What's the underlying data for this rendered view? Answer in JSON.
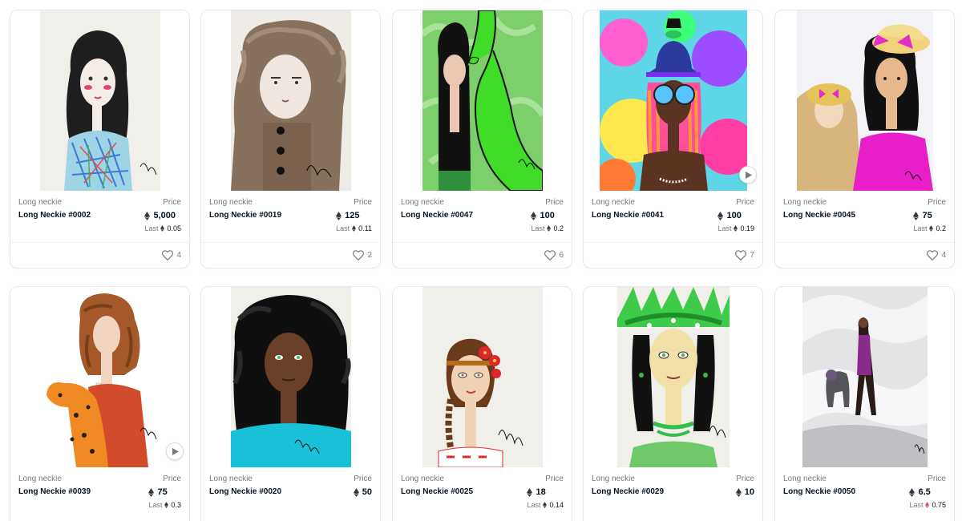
{
  "labels": {
    "price": "Price",
    "last": "Last"
  },
  "colors": {
    "eth_dark": "#353840",
    "eth_pink": "#e0467a",
    "muted": "#707a83",
    "text": "#04111d"
  },
  "items": [
    {
      "collection": "Long neckie",
      "name": "Long Neckie #0002",
      "price": "5,000",
      "last": "0.05",
      "likes": "4",
      "art": "pale-bg-dark-hair-pink-blush"
    },
    {
      "collection": "Long neckie",
      "name": "Long Neckie #0019",
      "price": "125",
      "last": "0.11",
      "likes": "2",
      "art": "fur-hood-brown"
    },
    {
      "collection": "Long neckie",
      "name": "Long Neckie #0047",
      "price": "100",
      "last": "0.2",
      "likes": "6",
      "art": "green-dinosaur"
    },
    {
      "collection": "Long neckie",
      "name": "Long Neckie #0041",
      "price": "100",
      "last": "0.19",
      "likes": "7",
      "art": "neon-bucket-hat",
      "video": true
    },
    {
      "collection": "Long neckie",
      "name": "Long Neckie #0045",
      "price": "75",
      "last": "0.2",
      "likes": "4",
      "art": "gold-hats-pink-bows"
    },
    {
      "collection": "Long neckie",
      "name": "Long Neckie #0039",
      "price": "75",
      "last": "0.3",
      "art": "leopard-red-jacket",
      "video": true
    },
    {
      "collection": "Long neckie",
      "name": "Long Neckie #0020",
      "price": "50",
      "art": "afro-turquoise"
    },
    {
      "collection": "Long neckie",
      "name": "Long Neckie #0025",
      "price": "18",
      "last": "0.14",
      "art": "braid-red-flowers"
    },
    {
      "collection": "Long neckie",
      "name": "Long Neckie #0029",
      "price": "10",
      "art": "green-feather-crown"
    },
    {
      "collection": "Long neckie",
      "name": "Long Neckie #0050",
      "price": "6.5",
      "last": "0.75",
      "last_color": "pink",
      "art": "misty-panther"
    }
  ]
}
